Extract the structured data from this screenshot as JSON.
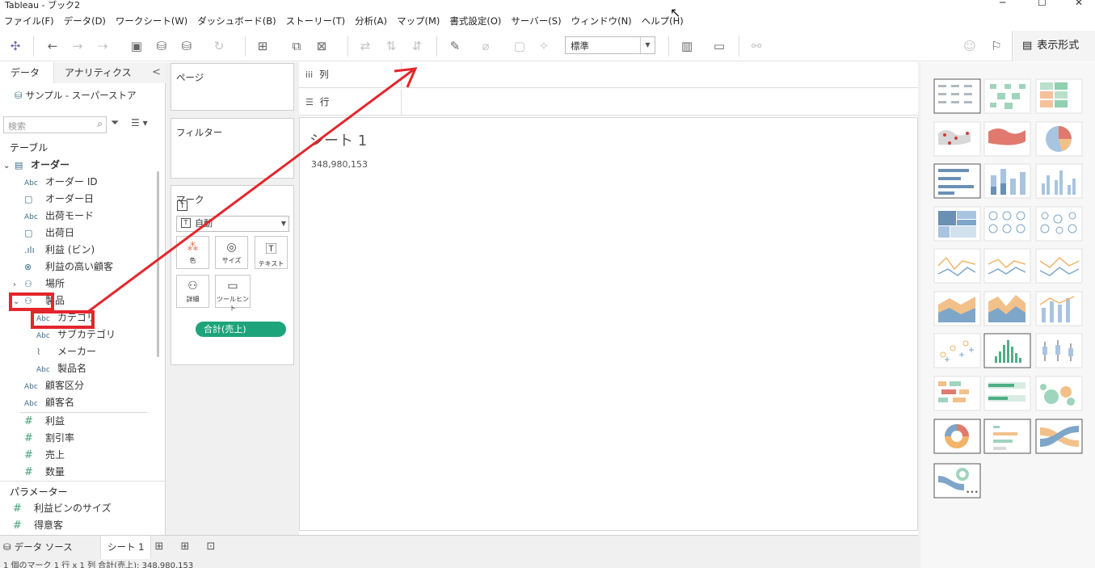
{
  "window": {
    "title": "Tableau - ブック2",
    "minimize": "─",
    "maximize": "☐",
    "close": "✕"
  },
  "menu": [
    "ファイル(F)",
    "データ(D)",
    "ワークシート(W)",
    "ダッシュボード(B)",
    "ストーリー(T)",
    "分析(A)",
    "マップ(M)",
    "書式設定(O)",
    "サーバー(S)",
    "ウィンドウ(N)",
    "ヘルプ(H)"
  ],
  "toolbar": {
    "fit_select": "標準",
    "show_me_label": "表示形式"
  },
  "data_pane": {
    "tab_data": "データ",
    "tab_analytics": "アナリティクス",
    "collapse": "<",
    "data_source": "サンプル - スーパーストア",
    "search_placeholder": "検索",
    "tables_heading": "テーブル",
    "table_name": "オーダー",
    "fields": [
      {
        "icon": "Abc",
        "label": "オーダー ID"
      },
      {
        "icon": "📅",
        "label": "オーダー日"
      },
      {
        "icon": "Abc",
        "label": "出荷モード"
      },
      {
        "icon": "📅",
        "label": "出荷日"
      },
      {
        "icon": ".ılı",
        "label": "利益 (ビン)"
      },
      {
        "icon": "⊗",
        "label": "利益の高い顧客"
      },
      {
        "icon": "品",
        "label": "場所"
      },
      {
        "icon": "品",
        "label": "製品"
      },
      {
        "icon": "Abc",
        "label": "カテゴリ"
      },
      {
        "icon": "Abc",
        "label": "サブカテゴリ"
      },
      {
        "icon": "🔗",
        "label": "メーカー"
      },
      {
        "icon": "Abc",
        "label": "製品名"
      },
      {
        "icon": "Abc",
        "label": "顧客区分"
      },
      {
        "icon": "Abc",
        "label": "顧客名"
      },
      {
        "icon": "#",
        "label": "利益"
      },
      {
        "icon": "#",
        "label": "割引率"
      },
      {
        "icon": "#",
        "label": "売上"
      },
      {
        "icon": "#",
        "label": "数量"
      }
    ],
    "parameters_heading": "パラメーター",
    "parameters": [
      {
        "icon": "#",
        "label": "利益ビンのサイズ"
      },
      {
        "icon": "#",
        "label": "得意客"
      }
    ]
  },
  "cards": {
    "pages": "ページ",
    "filters": "フィルター",
    "marks": "マーク",
    "mark_type": "自動",
    "mark_buttons": [
      {
        "label": "色"
      },
      {
        "label": "サイズ"
      },
      {
        "label": "テキスト"
      },
      {
        "label": "詳細"
      },
      {
        "label": "ツールヒント"
      }
    ],
    "pill": "合計(売上)"
  },
  "shelves": {
    "columns": "列",
    "rows": "行"
  },
  "sheet": {
    "title": "シート 1",
    "value": "348,980,153"
  },
  "bottom": {
    "data_source_tab": "データ ソース",
    "sheet_tab": "シート 1"
  },
  "status": "1 個のマーク   1 行 x 1 列   合計(売上): 348,980,153",
  "colors": {
    "accent_green": "#1ea47a",
    "annotation_red": "#e3262b",
    "icon_blue": "#3b6e8a"
  }
}
